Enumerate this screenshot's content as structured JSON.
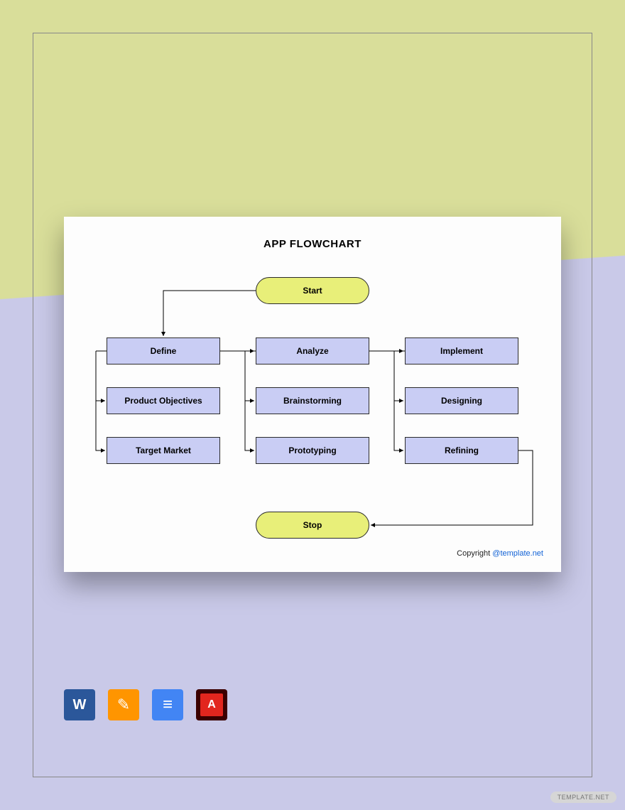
{
  "title": "APP FLOWCHART",
  "terminals": {
    "start": "Start",
    "stop": "Stop"
  },
  "columns": [
    {
      "head": "Define",
      "items": [
        "Product Objectives",
        "Target Market"
      ]
    },
    {
      "head": "Analyze",
      "items": [
        "Brainstorming",
        "Prototyping"
      ]
    },
    {
      "head": "Implement",
      "items": [
        "Designing",
        "Refining"
      ]
    }
  ],
  "copyright": {
    "text": "Copyright ",
    "link_label": "@template.net"
  },
  "apps": [
    "word",
    "pages",
    "google-docs",
    "pdf"
  ],
  "watermark": "TEMPLATE.NET"
}
